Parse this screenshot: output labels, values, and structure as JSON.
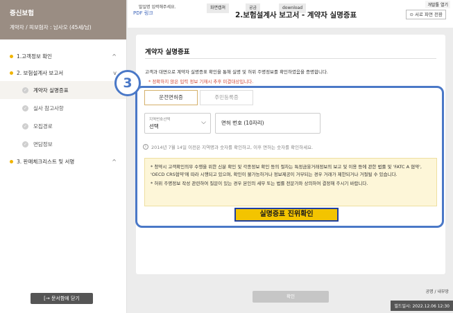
{
  "sidebar": {
    "company": "증신보험",
    "subtitle": "계약자 / 피보험자 : 남사오 (45세/남)",
    "sections": [
      {
        "label": "1.고객정보 확인",
        "chevron": "^"
      },
      {
        "label": "2. 보험설계사 보고서",
        "chevron": "v"
      },
      {
        "label": "3. 판매체크리스트 및 서명",
        "chevron": "^"
      }
    ],
    "sub_items": [
      "계약자 실명증표",
      "실사 참고사항",
      "모집경로",
      "면담정보"
    ],
    "close_button": "[→ 문서함에 닫기"
  },
  "topbar": {
    "pdf_link": "PDF 링크",
    "overlay_text": "발일명 입력해주세요.",
    "chip1": "화면캡쳐",
    "chip2": "궁금",
    "chip3": "download",
    "page_title": "2.보험설계사 보고서 - 계약자 실명증표",
    "guide_button": "⊙ 서로 파면 전환",
    "open_button": "개발툴 열기"
  },
  "card": {
    "title": "계약자 실명증표",
    "description": "고객과 대면으로 계약자 실명증표 확인을 통해 실명 및 허위 주명정보를 확인하였음을 증명합니다.",
    "warning": "* 정확하지 않은 입력 정보 기재시 추후 미결대상입니다.",
    "tabs": [
      "운전면허증",
      "주민등록증"
    ],
    "region_label": "지역번호선택",
    "region_value": "선택",
    "license_value": "면허 번호 (10자리)",
    "info_text": "2014년 7월 14일 이전은 지역명과 숫자를 확인하고, 이후 면허는 숫자를 확인하세요.",
    "notice_lines": [
      "* 청약시 고객확인의무 수행을 위한 신분 확인 및 각종정보 확인 등의 절차는 특정금융거래정보의 보고 및 이용 등에 관한 법률 및 'FATC A 협약', 'OECD CRS협약'에 따라 시행되고 있으며, 확인이 불가능하거나 정보제공이 거부되는 경우 거래가 제한되거나 거절될 수 있습니다.",
      "* 허위 주명정보 작성 관련하여 질문이 있는 경우 본인의 세무 또는 법률 전문가와 상의하여 결정해 주시기 바랍니다."
    ],
    "verify_button": "실명증표 진위확인"
  },
  "step_badge": "3",
  "footer": {
    "confirm_button": "확인",
    "label": "공명 / 내부망",
    "build_date": "빌드일시: 2022.12.06 12:30"
  }
}
